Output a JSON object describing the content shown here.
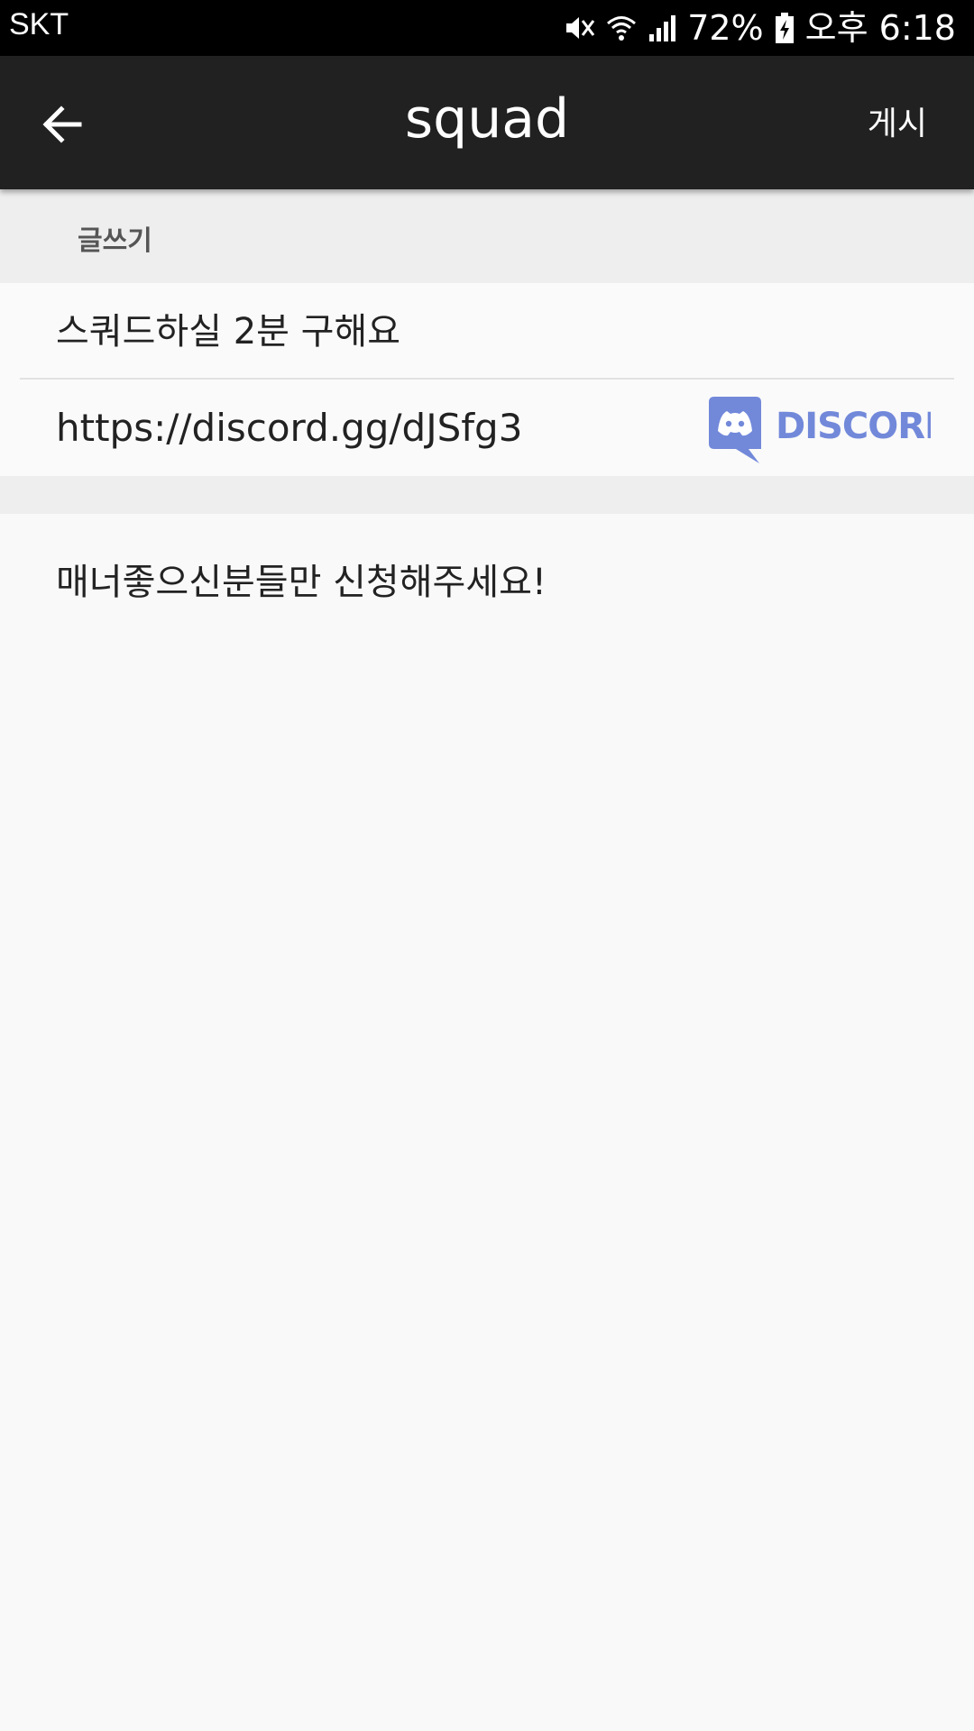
{
  "status_bar": {
    "carrier": "SKT",
    "battery": "72%",
    "time": "오후 6:18",
    "icons": [
      "mute-icon",
      "wifi-icon",
      "signal-icon",
      "battery-charging-icon"
    ]
  },
  "app_bar": {
    "title": "squad",
    "back_icon": "arrow-left-icon",
    "post_label": "게시"
  },
  "section": {
    "label": "글쓰기"
  },
  "form": {
    "title_value": "스쿼드하실 2분 구해요",
    "link_value": "https://discord.gg/dJSfg3",
    "link_service_logo": "discord-logo",
    "link_service_text": "DISCORD",
    "content_value": "매너좋으신분들만 신청해주세요!"
  },
  "colors": {
    "status_bar": "#000000",
    "app_bar": "#212121",
    "section_bg": "#eeeeee",
    "page_bg": "#f9f9f9",
    "discord_brand": "#7289da"
  }
}
